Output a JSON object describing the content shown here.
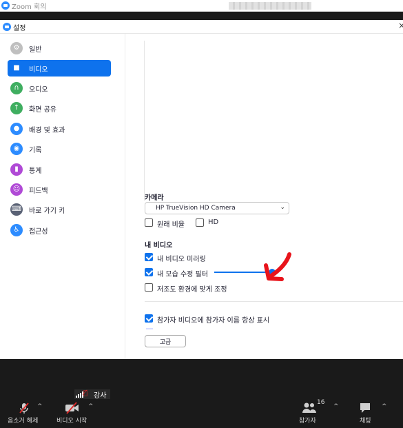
{
  "meeting_window": {
    "title": "Zoom 회의"
  },
  "settings": {
    "title": "설정",
    "close": "×",
    "sidebar": [
      {
        "label": "일반",
        "icon": "gear-icon",
        "color": "#bfbfbf",
        "glyph": "⚙"
      },
      {
        "label": "비디오",
        "icon": "video-camera-icon",
        "color": "#0e72ed",
        "glyph": "■"
      },
      {
        "label": "오디오",
        "icon": "headphones-icon",
        "color": "#3fae60",
        "glyph": "∩"
      },
      {
        "label": "화면 공유",
        "icon": "screen-share-icon",
        "color": "#3fae60",
        "glyph": "↑"
      },
      {
        "label": "배경 및 효과",
        "icon": "background-person-icon",
        "color": "#2d8cff",
        "glyph": "●"
      },
      {
        "label": "기록",
        "icon": "record-icon",
        "color": "#2d8cff",
        "glyph": "◉"
      },
      {
        "label": "통계",
        "icon": "statistics-icon",
        "color": "#b04ad6",
        "glyph": "▮"
      },
      {
        "label": "피드백",
        "icon": "feedback-smile-icon",
        "color": "#b04ad6",
        "glyph": "☺"
      },
      {
        "label": "바로 가기 키",
        "icon": "keyboard-icon",
        "color": "#5a6275",
        "glyph": "⌨"
      },
      {
        "label": "접근성",
        "icon": "accessibility-icon",
        "color": "#2d8cff",
        "glyph": "♿"
      }
    ],
    "active_index": 1,
    "camera_label": "카메라",
    "camera_value": "HP TrueVision HD Camera",
    "original_ratio": {
      "label": "원래 비율",
      "checked": false
    },
    "hd": {
      "label": "HD",
      "checked": false
    },
    "my_video_label": "내 비디오",
    "mirror": {
      "label": "내 비디오 미러링",
      "checked": true
    },
    "touch_up": {
      "label": "내 모습 수정 필터",
      "checked": true,
      "level": 1.0
    },
    "low_light": {
      "label": "저조도 환경에 맞게 조정",
      "checked": false
    },
    "show_names": {
      "label": "참가자 비디오에 참가자 이름 항상 표시",
      "checked": true
    },
    "advanced_button": "고급",
    "arrow_color": "#e8141b"
  },
  "meeting_toolbar": {
    "speaker_name": "강사",
    "mute": {
      "label": "음소거 해제",
      "icon": "muted-microphone-icon"
    },
    "video": {
      "label": "비디오 시작",
      "icon": "video-off-icon"
    },
    "participants": {
      "label": "참가자",
      "count": "16",
      "icon": "participants-icon"
    },
    "chat": {
      "label": "채팅",
      "icon": "chat-bubble-icon"
    },
    "caret": "^"
  }
}
